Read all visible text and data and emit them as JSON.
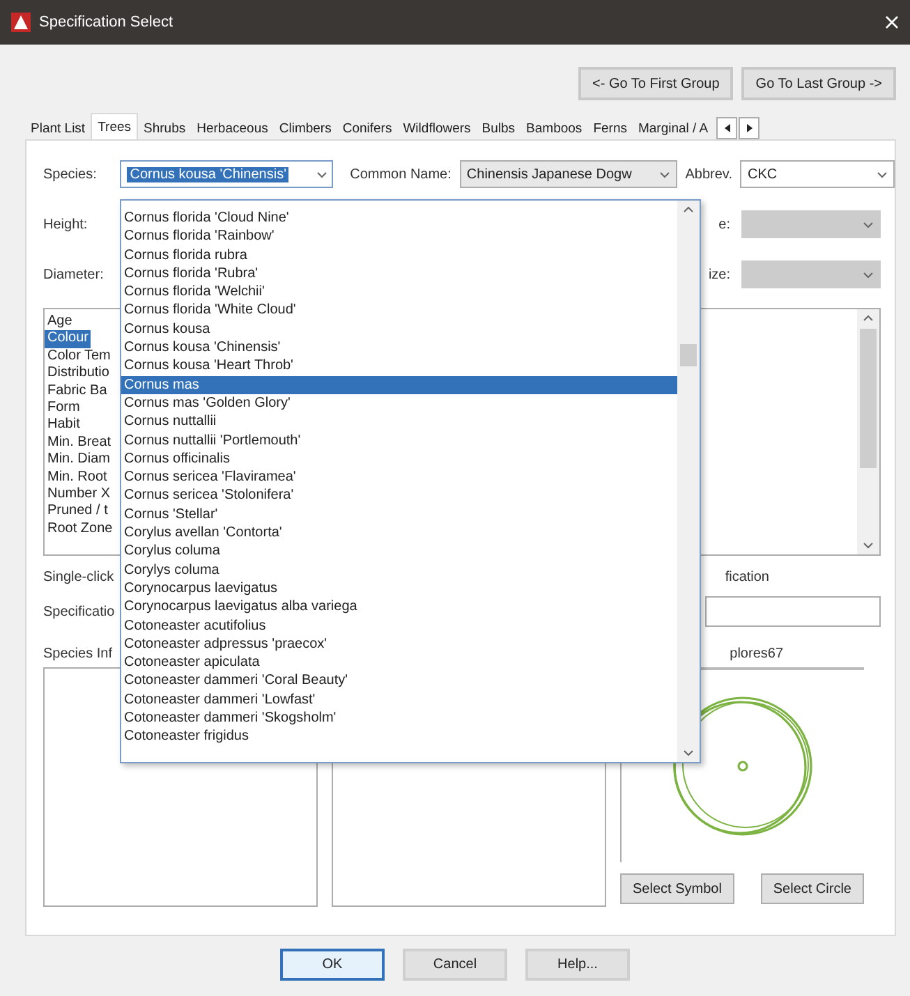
{
  "window": {
    "title": "Specification Select"
  },
  "group_nav": [
    {
      "label": "<- Go To First Group"
    },
    {
      "label": "Go To Last Group ->"
    }
  ],
  "tabs": [
    {
      "label": "Plant List",
      "selected": false
    },
    {
      "label": "Trees",
      "selected": true
    },
    {
      "label": "Shrubs",
      "selected": false
    },
    {
      "label": "Herbaceous",
      "selected": false
    },
    {
      "label": "Climbers",
      "selected": false
    },
    {
      "label": "Conifers",
      "selected": false
    },
    {
      "label": "Wildflowers",
      "selected": false
    },
    {
      "label": "Bulbs",
      "selected": false
    },
    {
      "label": "Bamboos",
      "selected": false
    },
    {
      "label": "Ferns",
      "selected": false
    },
    {
      "label": "Marginal / A",
      "selected": false
    }
  ],
  "species": {
    "label": "Species:",
    "value": "Cornus kousa 'Chinensis'"
  },
  "common_name": {
    "label": "Common Name:",
    "value": "Chinensis Japanese Dogw"
  },
  "abbrev": {
    "label": "Abbrev.",
    "value": "CKC"
  },
  "height": {
    "label": "Height:",
    "right_label": "e:",
    "right_disabled": true
  },
  "diameter": {
    "label": "Diameter:",
    "right_label": "ize:",
    "right_disabled": true
  },
  "properties": [
    {
      "label": "Age",
      "selected": false
    },
    {
      "label": "Colour",
      "selected": true
    },
    {
      "label": "Color Tem",
      "selected": false
    },
    {
      "label": "Distributio",
      "selected": false
    },
    {
      "label": "Fabric Ba",
      "selected": false
    },
    {
      "label": "Form",
      "selected": false
    },
    {
      "label": "Habit",
      "selected": false
    },
    {
      "label": "Min. Breat",
      "selected": false
    },
    {
      "label": "Min. Diam",
      "selected": false
    },
    {
      "label": "Min. Root",
      "selected": false
    },
    {
      "label": "Number X",
      "selected": false
    },
    {
      "label": "Pruned / t",
      "selected": false
    },
    {
      "label": "Root Zone",
      "selected": false
    }
  ],
  "hint": {
    "left": "Single-click",
    "right": "fication"
  },
  "specification": {
    "label": "Specificatio"
  },
  "species_info": {
    "label": "Species Inf"
  },
  "preview": {
    "label": "plores67"
  },
  "preview_buttons": [
    "Select Symbol",
    "Select Circle"
  ],
  "dropdown": {
    "items": [
      {
        "label": "Cornus florida 'Cloud Nine'",
        "selected": false
      },
      {
        "label": "Cornus florida 'Rainbow'",
        "selected": false
      },
      {
        "label": "Cornus florida rubra",
        "selected": false
      },
      {
        "label": "Cornus florida 'Rubra'",
        "selected": false
      },
      {
        "label": "Cornus florida 'Welchii'",
        "selected": false
      },
      {
        "label": "Cornus florida 'White Cloud'",
        "selected": false
      },
      {
        "label": "Cornus kousa",
        "selected": false
      },
      {
        "label": "Cornus kousa 'Chinensis'",
        "selected": false
      },
      {
        "label": "Cornus kousa 'Heart Throb'",
        "selected": false
      },
      {
        "label": "Cornus mas",
        "selected": true
      },
      {
        "label": "Cornus mas 'Golden Glory'",
        "selected": false
      },
      {
        "label": "Cornus nuttallii",
        "selected": false
      },
      {
        "label": "Cornus nuttallii 'Portlemouth'",
        "selected": false
      },
      {
        "label": "Cornus officinalis",
        "selected": false
      },
      {
        "label": "Cornus sericea 'Flaviramea'",
        "selected": false
      },
      {
        "label": "Cornus sericea 'Stolonifera'",
        "selected": false
      },
      {
        "label": "Cornus 'Stellar'",
        "selected": false
      },
      {
        "label": "Corylus avellan 'Contorta'",
        "selected": false
      },
      {
        "label": "Corylus columa",
        "selected": false
      },
      {
        "label": "Corylys columa",
        "selected": false
      },
      {
        "label": "Corynocarpus laevigatus",
        "selected": false
      },
      {
        "label": "Corynocarpus laevigatus alba variega",
        "selected": false
      },
      {
        "label": "Cotoneaster acutifolius",
        "selected": false
      },
      {
        "label": "Cotoneaster adpressus 'praecox'",
        "selected": false
      },
      {
        "label": "Cotoneaster apiculata",
        "selected": false
      },
      {
        "label": "Cotoneaster dammeri 'Coral Beauty'",
        "selected": false
      },
      {
        "label": "Cotoneaster dammeri 'Lowfast'",
        "selected": false
      },
      {
        "label": "Cotoneaster dammeri 'Skogsholm'",
        "selected": false
      },
      {
        "label": "Cotoneaster frigidus",
        "selected": false
      }
    ]
  },
  "buttons": [
    {
      "label": "OK",
      "default": true
    },
    {
      "label": "Cancel",
      "default": false
    },
    {
      "label": "Help...",
      "default": false
    }
  ]
}
